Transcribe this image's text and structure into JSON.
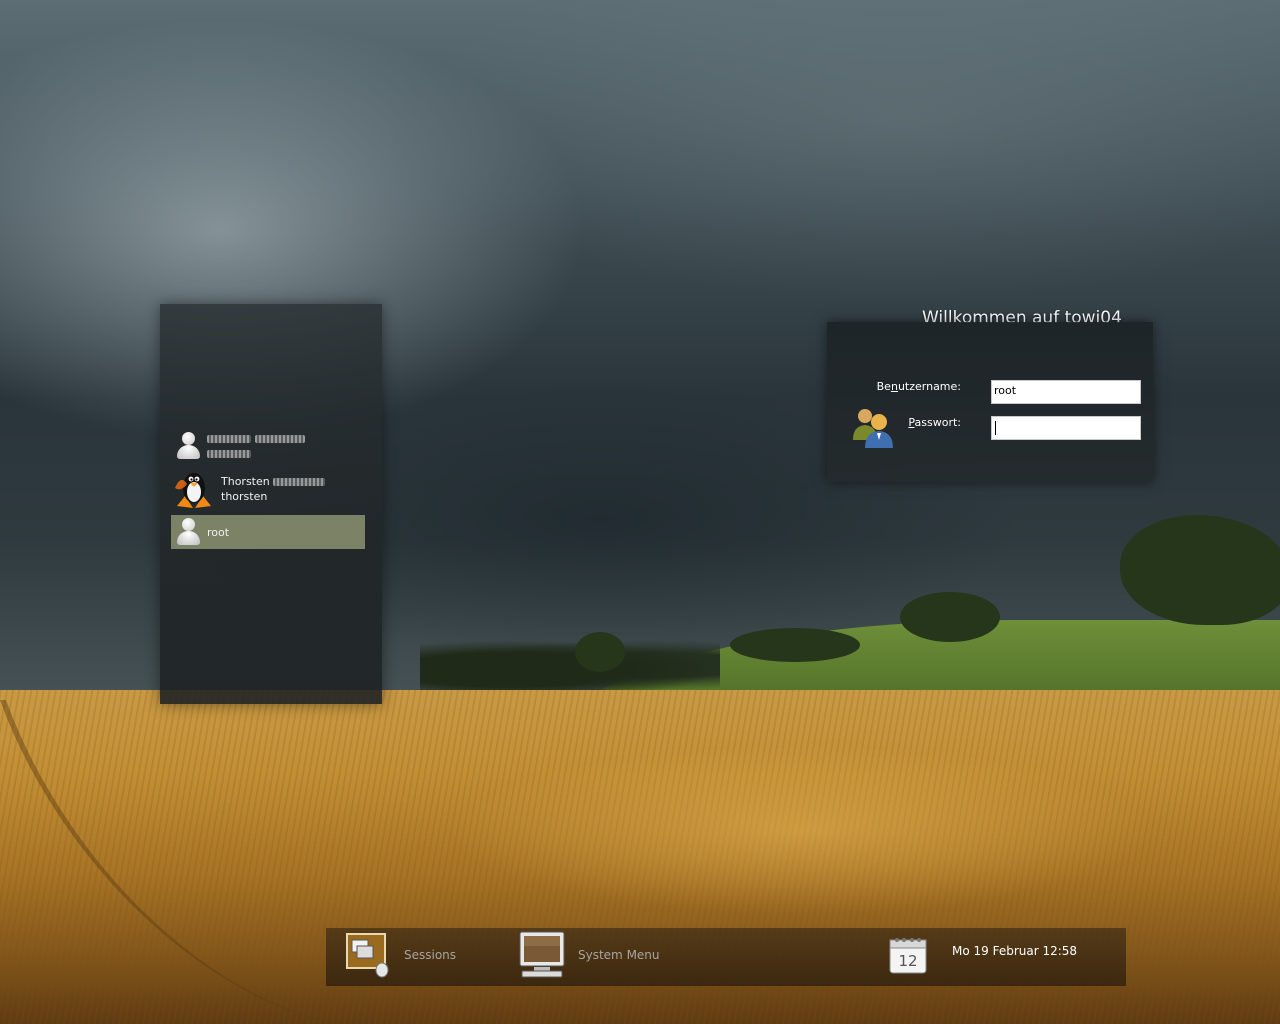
{
  "greeting": "Willkommen auf towi04",
  "users": [
    {
      "display_name": "",
      "login": "",
      "redacted": true,
      "icon": "generic-user-icon"
    },
    {
      "display_name": "Thorsten",
      "login": "thorsten",
      "redacted_surname": true,
      "icon": "tux-penguin-icon"
    },
    {
      "display_name": "root",
      "login": "",
      "selected": true,
      "icon": "generic-user-icon"
    }
  ],
  "form": {
    "username_label_pre": "Be",
    "username_label_acc": "n",
    "username_label_post": "utzername:",
    "username_value": "root",
    "password_label_acc": "P",
    "password_label_post": "asswort:",
    "password_value": ""
  },
  "bottom_bar": {
    "sessions_label": "Sessions",
    "system_menu_label": "System Menu",
    "calendar_day": "12",
    "clock": "Mo 19 Februar 12:58"
  },
  "colors": {
    "selected_user_bg": "#7b8266",
    "panel_bg": "#242a2c",
    "bar_label": "#a9a4a0"
  }
}
